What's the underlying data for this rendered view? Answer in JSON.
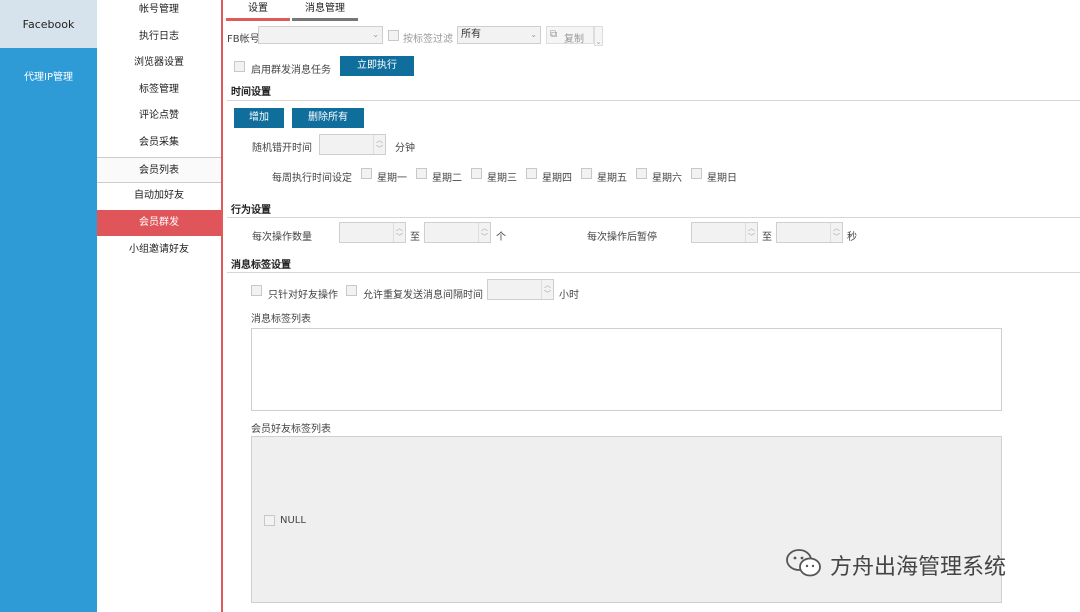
{
  "rail": {
    "facebook": "Facebook",
    "proxy": "代理IP管理"
  },
  "menu": [
    {
      "label": "帐号管理"
    },
    {
      "label": "执行日志"
    },
    {
      "label": "浏览器设置"
    },
    {
      "label": "标签管理"
    },
    {
      "label": "评论点赞"
    },
    {
      "label": "会员采集"
    },
    {
      "label": "会员列表"
    },
    {
      "label": "自动加好友"
    },
    {
      "label": "会员群发"
    },
    {
      "label": "小组邀请好友"
    }
  ],
  "tabs": [
    {
      "label": "设置"
    },
    {
      "label": "消息管理"
    }
  ],
  "toolbar": {
    "fb_account_label": "FB帐号",
    "fb_account_value": "",
    "tag_filter_label": "按标签过滤",
    "tag_filter_value": "所有",
    "copy_label": "复制"
  },
  "task": {
    "enable_label": "启用群发消息任务",
    "run_now": "立即执行"
  },
  "time": {
    "section": "时间设置",
    "add": "增加",
    "delete_all": "删除所有",
    "random_offset_label": "随机错开时间",
    "random_offset_value": "",
    "random_offset_unit": "分钟",
    "weekly_label": "每周执行时间设定",
    "days": [
      "星期一",
      "星期二",
      "星期三",
      "星期四",
      "星期五",
      "星期六",
      "星期日"
    ]
  },
  "behavior": {
    "section": "行为设置",
    "ops_count_label": "每次操作数量",
    "ops_count_min": "",
    "ops_count_max": "",
    "to": "至",
    "ops_count_unit": "个",
    "pause_label": "每次操作后暂停",
    "pause_min": "",
    "pause_max": "",
    "pause_unit": "秒"
  },
  "tags": {
    "section": "消息标签设置",
    "friends_only": "只针对好友操作",
    "allow_repeat": "允许重复发送消息间隔时间",
    "repeat_value": "",
    "repeat_unit": "小时",
    "msg_tag_list_label": "消息标签列表",
    "member_tag_list_label": "会员好友标签列表",
    "member_tag_items": [
      "NULL"
    ]
  },
  "watermark": "方舟出海管理系统",
  "colors": {
    "rail_bg": "#2e9bd6",
    "active_menu": "#e0555a",
    "primary_button": "#0f6e9c",
    "tab_active_underline": "#e05a5a",
    "tab_inactive_underline": "#777777"
  }
}
